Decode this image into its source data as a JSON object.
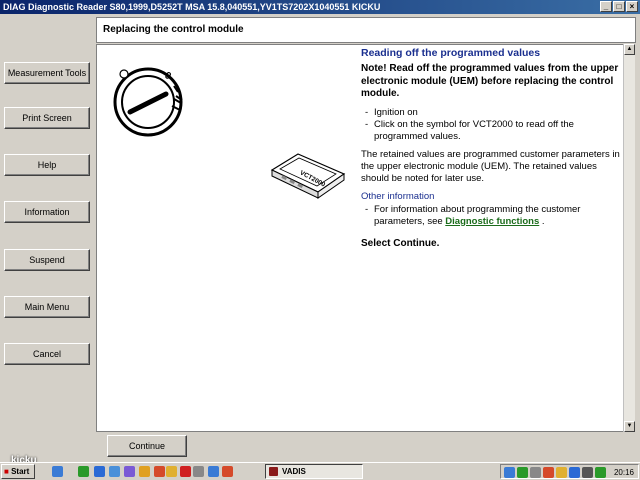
{
  "window": {
    "title": "DIAG Diagnostic Reader S80,1999,D5252T MSA 15.8,040551,YV1TS7202X1040551 KICKU"
  },
  "sidebar": {
    "buttons": [
      "Measurement Tools",
      "Print Screen",
      "Help",
      "Information",
      "Suspend",
      "Main Menu",
      "Cancel"
    ]
  },
  "header": {
    "title": "Replacing the control module"
  },
  "content": {
    "heading": "Reading off the programmed values",
    "note": "Note! Read off the programmed values from the upper electronic module (UEM) before replacing the control module.",
    "steps": [
      "Ignition on",
      "Click on the symbol for VCT2000 to read off the programmed values."
    ],
    "paragraph": "The retained values are programmed customer parameters in the upper electronic module (UEM). The retained values should be noted for later use.",
    "other_heading": "Other information",
    "other_text": "For information about programming the customer parameters, see",
    "other_link": "Diagnostic functions",
    "other_end": ".",
    "select": "Select Continue."
  },
  "footer": {
    "continue_label": "Continue"
  },
  "device": {
    "label": "VCT2000"
  },
  "taskbar": {
    "start_label": "Start",
    "task_label": "VADIS",
    "clock": "20:16"
  },
  "watermark": "kicku",
  "colors": {
    "heading": "#1a2f8f",
    "link": "#1a6b1a",
    "titlebar": "#0a246a"
  }
}
